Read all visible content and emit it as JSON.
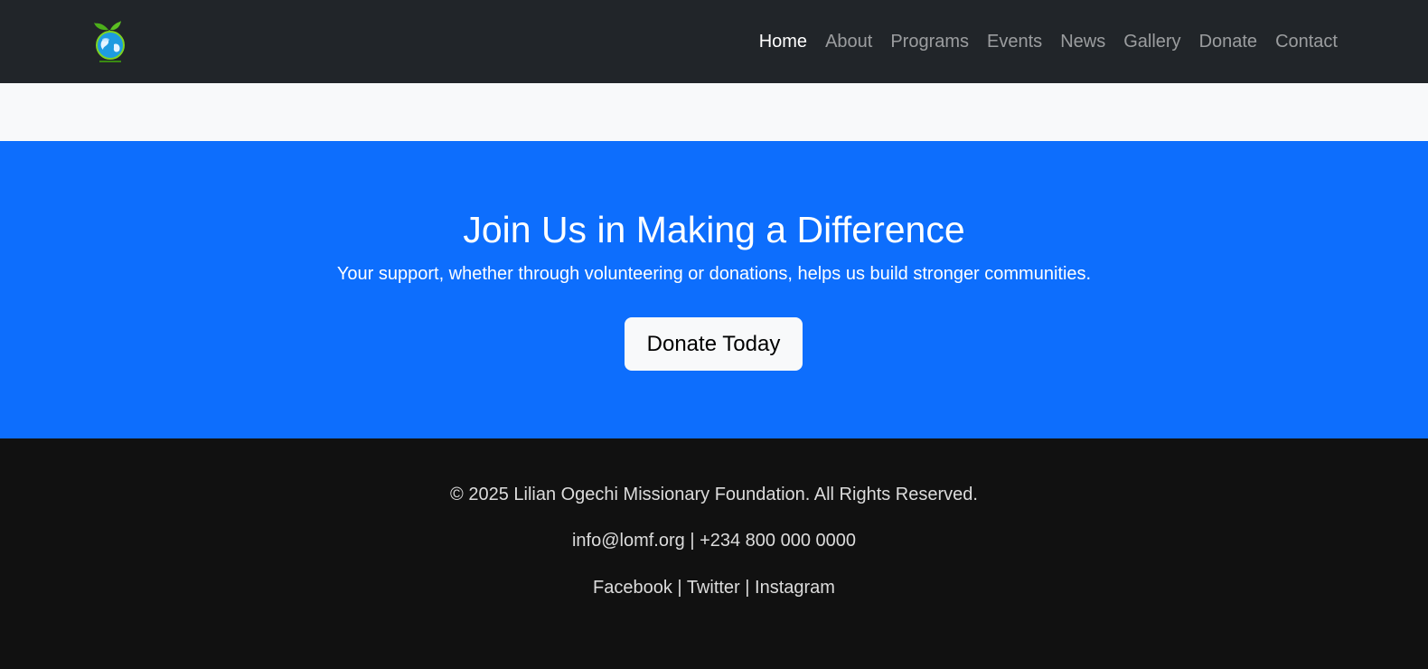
{
  "nav": {
    "logo_icon": "globe-sprout-logo-icon",
    "links": [
      {
        "label": "Home",
        "active": true
      },
      {
        "label": "About"
      },
      {
        "label": "Programs"
      },
      {
        "label": "Events"
      },
      {
        "label": "News"
      },
      {
        "label": "Gallery"
      },
      {
        "label": "Donate"
      },
      {
        "label": "Contact"
      }
    ]
  },
  "cta": {
    "title": "Join Us in Making a Difference",
    "subtitle": "Your support, whether through volunteering or donations, helps us build stronger communities.",
    "button_label": "Donate Today"
  },
  "footer": {
    "copyright": "© 2025 Lilian Ogechi Missionary Foundation. All Rights Reserved.",
    "email": "info@lomf.org",
    "phone": "+234 800 000 0000",
    "separator": " | ",
    "social": [
      "Facebook",
      "Twitter",
      "Instagram"
    ]
  },
  "colors": {
    "navbar_bg": "#212529",
    "strip_bg": "#f8f9fa",
    "cta_bg": "#0d6efd",
    "footer_bg": "#111111"
  }
}
